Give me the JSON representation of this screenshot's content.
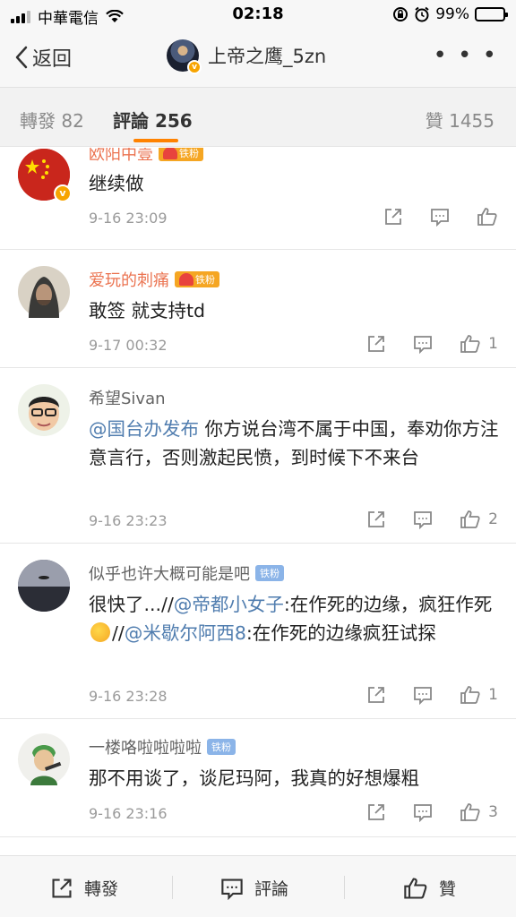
{
  "status_bar": {
    "carrier": "中華電信",
    "time": "02:18",
    "battery": "99%",
    "battery_level": 0.99,
    "icons": [
      "signal-icon",
      "wifi-icon",
      "rotation-lock-icon",
      "alarm-icon",
      "battery-icon"
    ]
  },
  "nav": {
    "back_label": "返回",
    "title": "上帝之鹰_5zn",
    "more_label": "• • •"
  },
  "tabs": {
    "repost_label": "轉發",
    "repost_count": "82",
    "comment_label": "評論",
    "comment_count": "256",
    "like_label": "贊",
    "like_count": "1455",
    "active": "comment",
    "accent_color": "#ff8200"
  },
  "comments": [
    {
      "name": "欧阳中壹",
      "badge": "铁粉",
      "verified": true,
      "text": "继续做",
      "time": "9-16 23:09",
      "likes": ""
    },
    {
      "name": "爱玩的刺痛",
      "badge": "铁粉",
      "verified": false,
      "text": "敢签 就支持td",
      "time": "9-17 00:32",
      "likes": "1"
    },
    {
      "name": "希望Sivan",
      "badge": "",
      "verified": false,
      "mention": "@国台办发布",
      "text": " 你方说台湾不属于中国，奉劝你方注意言行，否则激起民愤，到时候下不来台",
      "time": "9-16 23:23",
      "likes": "2"
    },
    {
      "name": "似乎也许大概可能是吧",
      "badge": "铁粉",
      "verified": false,
      "text_parts": [
        "很快了...//",
        "@帝都小女子",
        ":在作死的边缘，疯狂作死 ",
        "//",
        "@米歇尔阿西8",
        ":在作死的边缘疯狂试探"
      ],
      "time": "9-16 23:28",
      "likes": "1"
    },
    {
      "name": "一楼咯啦啦啦啦",
      "badge": "铁粉",
      "verified": false,
      "text": "那不用谈了，谈尼玛阿，我真的好想爆粗",
      "time": "9-16 23:16",
      "likes": "3"
    }
  ],
  "bottom_bar": {
    "repost_label": "轉發",
    "comment_label": "評論",
    "like_label": "贊"
  },
  "colors": {
    "link": "#507daf",
    "name_highlight": "#eb7350",
    "badge_orange": "#f5a623",
    "badge_blue": "#8bb4e8"
  }
}
